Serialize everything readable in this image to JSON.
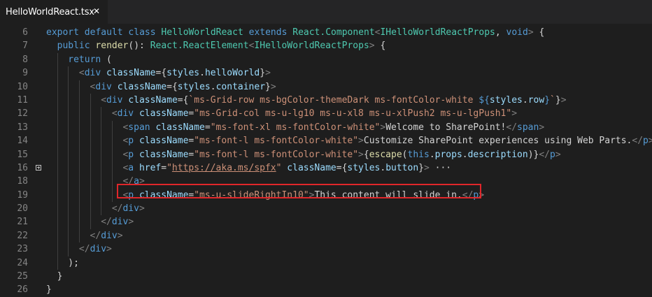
{
  "tab": {
    "title": "HelloWorldReact.tsx",
    "close_glyph": "✕"
  },
  "colors": {
    "keyword": "#569cd6",
    "type": "#4ec9b0",
    "function": "#dcdcaa",
    "attribute": "#9cdcfe",
    "string": "#ce9178",
    "punctuation": "#808080",
    "default": "#d4d4d4",
    "highlight_border": "#e0262a",
    "background": "#1e1e1e"
  },
  "fold_icon": "plus-square-icon",
  "lines": [
    {
      "n": "6",
      "indent": 0,
      "tokens": [
        [
          "k",
          "export"
        ],
        [
          "d",
          " "
        ],
        [
          "k",
          "default"
        ],
        [
          "d",
          " "
        ],
        [
          "k",
          "class"
        ],
        [
          "d",
          " "
        ],
        [
          "t",
          "HelloWorldReact"
        ],
        [
          "d",
          " "
        ],
        [
          "k",
          "extends"
        ],
        [
          "d",
          " "
        ],
        [
          "t",
          "React.Component"
        ],
        [
          "p",
          "<"
        ],
        [
          "t",
          "IHelloWorldReactProps"
        ],
        [
          "d",
          ", "
        ],
        [
          "k",
          "void"
        ],
        [
          "p",
          ">"
        ],
        [
          "d",
          " {"
        ]
      ]
    },
    {
      "n": "7",
      "indent": 1,
      "tokens": [
        [
          "k",
          "public"
        ],
        [
          "d",
          " "
        ],
        [
          "f",
          "render"
        ],
        [
          "d",
          "(): "
        ],
        [
          "t",
          "React.ReactElement"
        ],
        [
          "p",
          "<"
        ],
        [
          "t",
          "IHelloWorldReactProps"
        ],
        [
          "p",
          ">"
        ],
        [
          "d",
          " {"
        ]
      ]
    },
    {
      "n": "8",
      "indent": 2,
      "tokens": [
        [
          "k",
          "return"
        ],
        [
          "d",
          " ("
        ]
      ]
    },
    {
      "n": "9",
      "indent": 3,
      "tokens": [
        [
          "p",
          "<"
        ],
        [
          "k",
          "div"
        ],
        [
          "d",
          " "
        ],
        [
          "a",
          "className"
        ],
        [
          "d",
          "={"
        ],
        [
          "a",
          "styles"
        ],
        [
          "d",
          "."
        ],
        [
          "a",
          "helloWorld"
        ],
        [
          "d",
          "}"
        ],
        [
          "p",
          ">"
        ]
      ]
    },
    {
      "n": "10",
      "indent": 4,
      "tokens": [
        [
          "p",
          "<"
        ],
        [
          "k",
          "div"
        ],
        [
          "d",
          " "
        ],
        [
          "a",
          "className"
        ],
        [
          "d",
          "={"
        ],
        [
          "a",
          "styles"
        ],
        [
          "d",
          "."
        ],
        [
          "a",
          "container"
        ],
        [
          "d",
          "}"
        ],
        [
          "p",
          ">"
        ]
      ]
    },
    {
      "n": "11",
      "indent": 5,
      "tokens": [
        [
          "p",
          "<"
        ],
        [
          "k",
          "div"
        ],
        [
          "d",
          " "
        ],
        [
          "a",
          "className"
        ],
        [
          "d",
          "={"
        ],
        [
          "s",
          "`ms-Grid-row ms-bgColor-themeDark ms-fontColor-white "
        ],
        [
          "k",
          "${"
        ],
        [
          "a",
          "styles"
        ],
        [
          "d",
          "."
        ],
        [
          "a",
          "row"
        ],
        [
          "k",
          "}"
        ],
        [
          "s",
          "`"
        ],
        [
          "d",
          "}"
        ],
        [
          "p",
          ">"
        ]
      ]
    },
    {
      "n": "12",
      "indent": 6,
      "tokens": [
        [
          "p",
          "<"
        ],
        [
          "k",
          "div"
        ],
        [
          "d",
          " "
        ],
        [
          "a",
          "className"
        ],
        [
          "d",
          "="
        ],
        [
          "s",
          "\"ms-Grid-col ms-u-lg10 ms-u-xl8 ms-u-xlPush2 ms-u-lgPush1\""
        ],
        [
          "p",
          ">"
        ]
      ]
    },
    {
      "n": "13",
      "indent": 7,
      "tokens": [
        [
          "p",
          "<"
        ],
        [
          "k",
          "span"
        ],
        [
          "d",
          " "
        ],
        [
          "a",
          "className"
        ],
        [
          "d",
          "="
        ],
        [
          "s",
          "\"ms-font-xl ms-fontColor-white\""
        ],
        [
          "p",
          ">"
        ],
        [
          "d",
          "Welcome to SharePoint!"
        ],
        [
          "p",
          "</"
        ],
        [
          "k",
          "span"
        ],
        [
          "p",
          ">"
        ]
      ]
    },
    {
      "n": "14",
      "indent": 7,
      "tokens": [
        [
          "p",
          "<"
        ],
        [
          "k",
          "p"
        ],
        [
          "d",
          " "
        ],
        [
          "a",
          "className"
        ],
        [
          "d",
          "="
        ],
        [
          "s",
          "\"ms-font-l ms-fontColor-white\""
        ],
        [
          "p",
          ">"
        ],
        [
          "d",
          "Customize SharePoint experiences using Web Parts."
        ],
        [
          "p",
          "</"
        ],
        [
          "k",
          "p"
        ],
        [
          "p",
          ">"
        ]
      ]
    },
    {
      "n": "15",
      "indent": 7,
      "tokens": [
        [
          "p",
          "<"
        ],
        [
          "k",
          "p"
        ],
        [
          "d",
          " "
        ],
        [
          "a",
          "className"
        ],
        [
          "d",
          "="
        ],
        [
          "s",
          "\"ms-font-l ms-fontColor-white\""
        ],
        [
          "p",
          ">"
        ],
        [
          "d",
          "{"
        ],
        [
          "f",
          "escape"
        ],
        [
          "d",
          "("
        ],
        [
          "k",
          "this"
        ],
        [
          "d",
          "."
        ],
        [
          "a",
          "props"
        ],
        [
          "d",
          "."
        ],
        [
          "a",
          "description"
        ],
        [
          "d",
          ")}"
        ],
        [
          "p",
          "</"
        ],
        [
          "k",
          "p"
        ],
        [
          "p",
          ">"
        ]
      ]
    },
    {
      "n": "16",
      "indent": 7,
      "fold": true,
      "tokens": [
        [
          "p",
          "<"
        ],
        [
          "k",
          "a"
        ],
        [
          "d",
          " "
        ],
        [
          "a",
          "href"
        ],
        [
          "d",
          "="
        ],
        [
          "s",
          "\""
        ],
        [
          "u",
          "https://aka.ms/spfx"
        ],
        [
          "s",
          "\""
        ],
        [
          "d",
          " "
        ],
        [
          "a",
          "className"
        ],
        [
          "d",
          "={"
        ],
        [
          "a",
          "styles"
        ],
        [
          "d",
          "."
        ],
        [
          "a",
          "button"
        ],
        [
          "d",
          "}"
        ],
        [
          "p",
          ">"
        ],
        [
          "d",
          " ···"
        ]
      ]
    },
    {
      "n": "18",
      "indent": 7,
      "tokens": [
        [
          "p",
          "</"
        ],
        [
          "k",
          "a"
        ],
        [
          "p",
          ">"
        ]
      ]
    },
    {
      "n": "19",
      "indent": 7,
      "tokens": [
        [
          "p",
          "<"
        ],
        [
          "k",
          "p"
        ],
        [
          "d",
          " "
        ],
        [
          "a",
          "className"
        ],
        [
          "d",
          "="
        ],
        [
          "s",
          "\"ms-u-slideRightIn10\""
        ],
        [
          "p",
          ">"
        ],
        [
          "d",
          "This content will slide in."
        ],
        [
          "p",
          "</"
        ],
        [
          "k",
          "p"
        ],
        [
          "p",
          ">"
        ]
      ]
    },
    {
      "n": "20",
      "indent": 6,
      "tokens": [
        [
          "p",
          "</"
        ],
        [
          "k",
          "div"
        ],
        [
          "p",
          ">"
        ]
      ]
    },
    {
      "n": "21",
      "indent": 5,
      "tokens": [
        [
          "p",
          "</"
        ],
        [
          "k",
          "div"
        ],
        [
          "p",
          ">"
        ]
      ]
    },
    {
      "n": "22",
      "indent": 4,
      "tokens": [
        [
          "p",
          "</"
        ],
        [
          "k",
          "div"
        ],
        [
          "p",
          ">"
        ]
      ]
    },
    {
      "n": "23",
      "indent": 3,
      "tokens": [
        [
          "p",
          "</"
        ],
        [
          "k",
          "div"
        ],
        [
          "p",
          ">"
        ]
      ]
    },
    {
      "n": "24",
      "indent": 2,
      "tokens": [
        [
          "d",
          ");"
        ]
      ]
    },
    {
      "n": "25",
      "indent": 1,
      "tokens": [
        [
          "d",
          "}"
        ]
      ]
    },
    {
      "n": "26",
      "indent": 0,
      "tokens": [
        [
          "d",
          "}"
        ]
      ]
    }
  ]
}
